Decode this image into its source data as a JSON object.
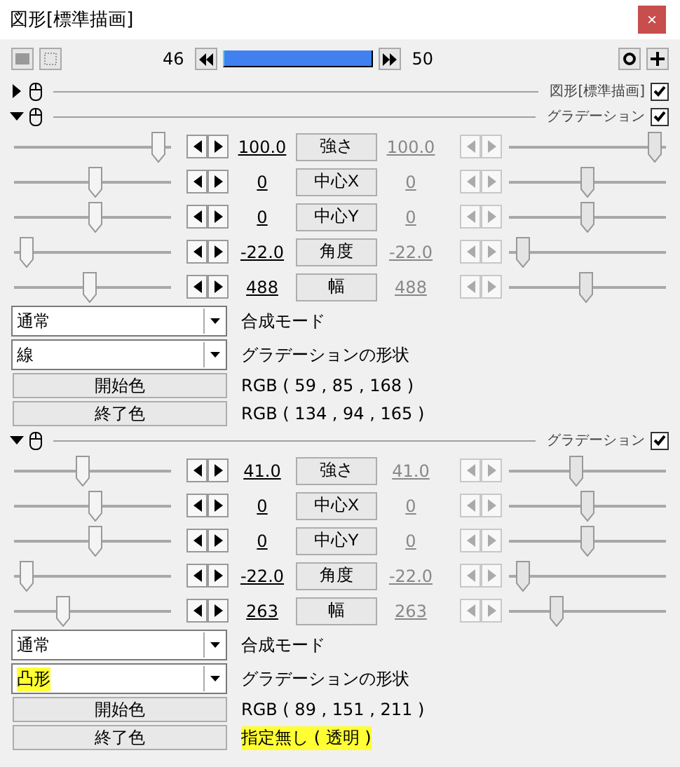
{
  "window": {
    "title": "図形[標準描画]",
    "close": "×"
  },
  "toolbar": {
    "start_frame": "46",
    "end_frame": "50",
    "level": 1
  },
  "effects": [
    {
      "title": "図形[標準描画]",
      "expanded": false,
      "checked": true
    },
    {
      "title": "グラデーション",
      "expanded": true,
      "checked": true,
      "rows": [
        {
          "name": "強さ",
          "start": {
            "value": "100.0",
            "level": 0.96
          },
          "end": {
            "value": "100.0",
            "level": 0.97
          }
        },
        {
          "name": "中心X",
          "start": {
            "value": "0",
            "level": 0.52
          },
          "end": {
            "value": "0",
            "level": 0.5
          }
        },
        {
          "name": "中心Y",
          "start": {
            "value": "0",
            "level": 0.52
          },
          "end": {
            "value": "0",
            "level": 0.5
          }
        },
        {
          "name": "角度",
          "start": {
            "value": "-22.0",
            "level": 0.04
          },
          "end": {
            "value": "-22.0",
            "level": 0.05
          }
        },
        {
          "name": "幅",
          "start": {
            "value": "488",
            "level": 0.48
          },
          "end": {
            "value": "488",
            "level": 0.49
          }
        }
      ],
      "selects": [
        {
          "value": "通常",
          "label": "合成モード",
          "highlighted": false
        },
        {
          "value": "線",
          "label": "グラデーションの形状",
          "highlighted": false
        }
      ],
      "colors": [
        {
          "button": "開始色",
          "value": "RGB ( 59 , 85 , 168 )",
          "highlighted": false
        },
        {
          "button": "終了色",
          "value": "RGB ( 134 , 94 , 165 )",
          "highlighted": false
        }
      ]
    },
    {
      "title": "グラデーション",
      "expanded": true,
      "checked": true,
      "rows": [
        {
          "name": "強さ",
          "start": {
            "value": "41.0",
            "level": 0.43
          },
          "end": {
            "value": "41.0",
            "level": 0.42
          }
        },
        {
          "name": "中心X",
          "start": {
            "value": "0",
            "level": 0.52
          },
          "end": {
            "value": "0",
            "level": 0.5
          }
        },
        {
          "name": "中心Y",
          "start": {
            "value": "0",
            "level": 0.52
          },
          "end": {
            "value": "0",
            "level": 0.5
          }
        },
        {
          "name": "角度",
          "start": {
            "value": "-22.0",
            "level": 0.04
          },
          "end": {
            "value": "-22.0",
            "level": 0.05
          }
        },
        {
          "name": "幅",
          "start": {
            "value": "263",
            "level": 0.29
          },
          "end": {
            "value": "263",
            "level": 0.28
          }
        }
      ],
      "selects": [
        {
          "value": "通常",
          "label": "合成モード",
          "highlighted": false
        },
        {
          "value": "凸形",
          "label": "グラデーションの形状",
          "highlighted": true
        }
      ],
      "colors": [
        {
          "button": "開始色",
          "value": "RGB ( 89 , 151 , 211 )",
          "highlighted": false
        },
        {
          "button": "終了色",
          "value": "指定無し ( 透明 )",
          "highlighted": true
        }
      ]
    }
  ]
}
